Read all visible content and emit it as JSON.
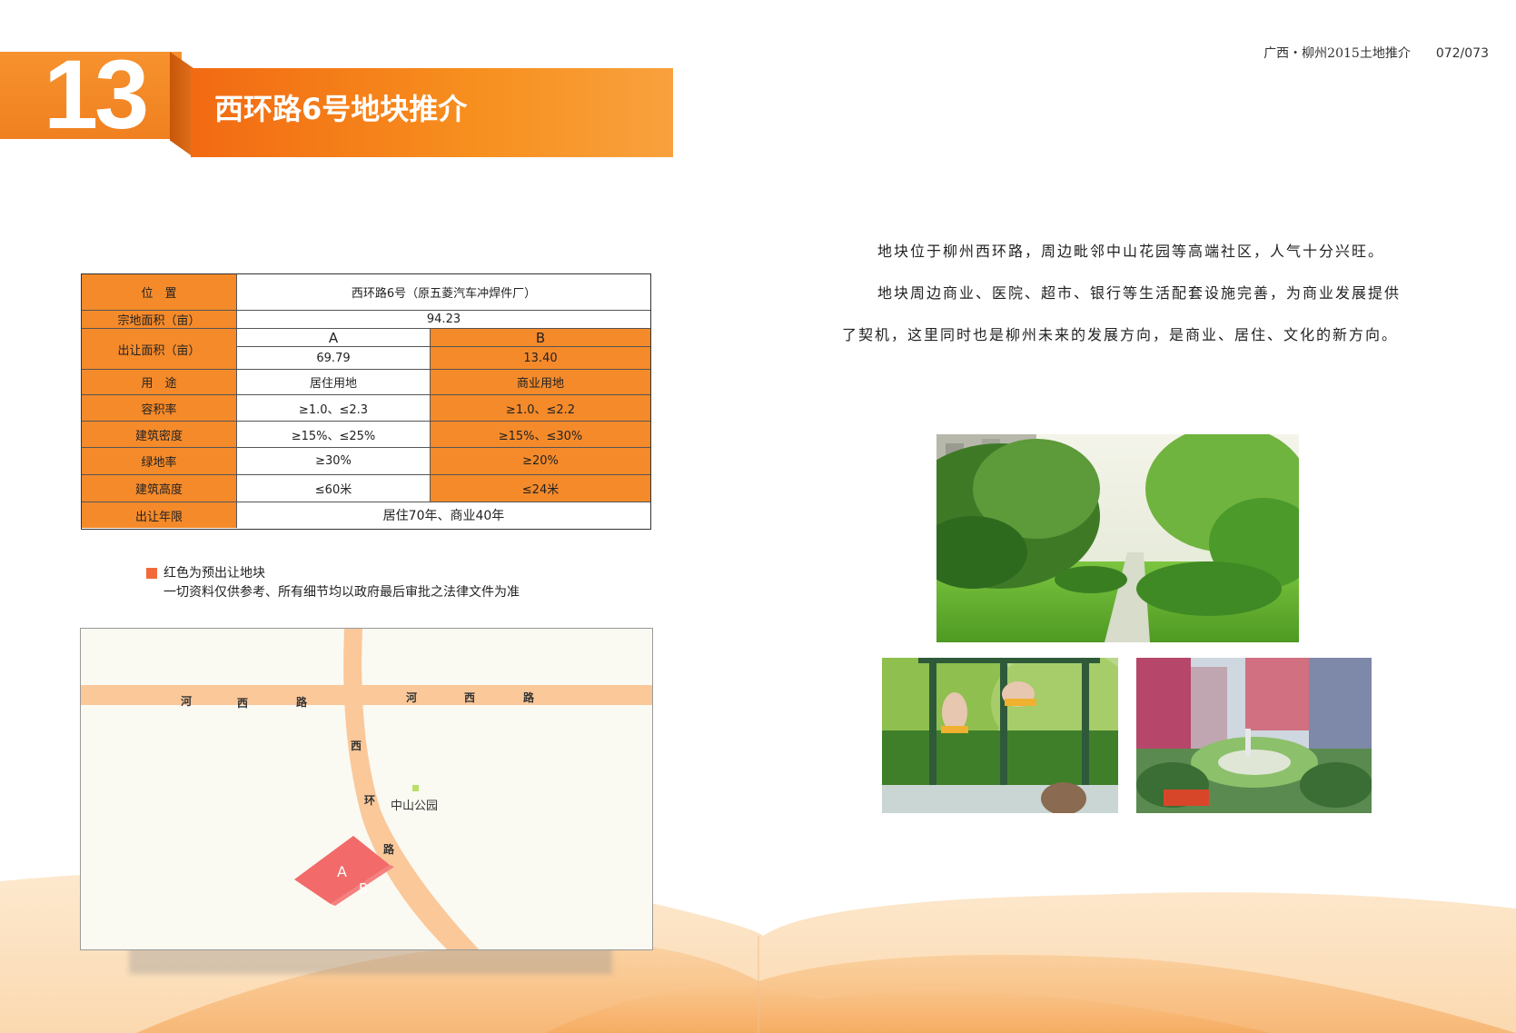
{
  "header": {
    "number": "13",
    "title": "西环路6号地块推介",
    "doc_title": "广西・柳州2015土地推介",
    "page_numbers": "072/073"
  },
  "table": {
    "location_label": "位　置",
    "location_value": "西环路6号（原五菱汽车冲焊件厂）",
    "total_area_label": "宗地面积（亩）",
    "total_area_value": "94.23",
    "transfer_area_label": "出让面积（亩）",
    "col_a": "A",
    "col_b": "B",
    "area_a": "69.79",
    "area_b": "13.40",
    "use_label": "用　途",
    "use_a": "居住用地",
    "use_b": "商业用地",
    "far_label": "容积率",
    "far_a": "≥1.0、≤2.3",
    "far_b": "≥1.0、≤2.2",
    "density_label": "建筑密度",
    "density_a": "≥15%、≤25%",
    "density_b": "≥15%、≤30%",
    "green_label": "绿地率",
    "green_a": "≥30%",
    "green_b": "≥20%",
    "height_label": "建筑高度",
    "height_a": "≤60米",
    "height_b": "≤24米",
    "term_label": "出让年限",
    "term_value": "居住70年、商业40年"
  },
  "notes": {
    "legend": "红色为预出让地块",
    "disclaimer": "一切资料仅供参考、所有细节均以政府最后审批之法律文件为准"
  },
  "map": {
    "road_top_left": [
      "河",
      "西",
      "路"
    ],
    "road_top_right": [
      "河",
      "西",
      "路"
    ],
    "road_west": [
      "西",
      "环",
      "路"
    ],
    "park": "中山公园",
    "parcel_a": "A",
    "parcel_b": "B",
    "parcel_color": "#f26a6a",
    "road_color": "#fbc89a"
  },
  "description": {
    "p1": "地块位于柳州西环路，周边毗邻中山花园等高端社区，人气十分兴旺。",
    "p2a": "地块周边商业、医院、超市、银行等生活配套设施完善，为商业发展提供",
    "p2b": "了契机，这里同时也是柳州未来的发展方向，是商业、居住、文化的新方向。"
  },
  "colors": {
    "brand_orange": "#f58a2a",
    "banner_orange": "#f26a12"
  }
}
